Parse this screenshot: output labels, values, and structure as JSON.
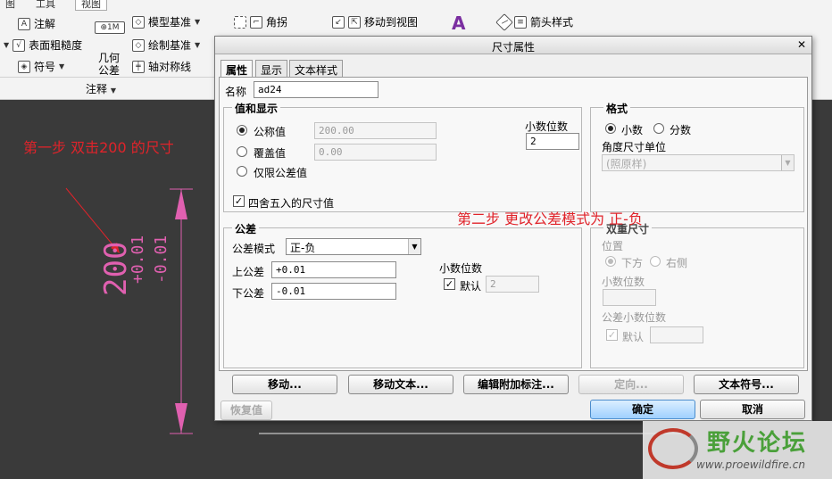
{
  "ribbon": {
    "tabs": [
      "图",
      "工具",
      "视图"
    ],
    "col1": [
      "注解",
      "表面粗糙度",
      "符号"
    ],
    "col2": [
      "1M",
      "几何",
      "公差"
    ],
    "col3": [
      "模型基准",
      "绘制基准",
      "轴对称线"
    ],
    "col4": [
      "角拐"
    ],
    "col5": [
      "移动到视图"
    ],
    "col6": [
      "箭头样式"
    ],
    "group_label": "注释"
  },
  "canvas": {
    "step1": "第一步  双击200 的尺寸",
    "step2": "第二步  更改公差模式为  正-负",
    "dim_value": "200",
    "tol_upper": "+0.01",
    "tol_lower": "-0.01"
  },
  "dialog": {
    "title": "尺寸属性",
    "tabs": [
      "属性",
      "显示",
      "文本样式"
    ],
    "name_label": "名称",
    "name_value": "ad24",
    "value_group": {
      "title": "值和显示",
      "nominal_label": "公称值",
      "nominal_value": "200.00",
      "override_label": "覆盖值",
      "override_value": "0.00",
      "tol_only_label": "仅限公差值",
      "decimals_label": "小数位数",
      "decimals_value": "2",
      "round_label": "四舍五入的尺寸值"
    },
    "format_group": {
      "title": "格式",
      "decimal_label": "小数",
      "fraction_label": "分数",
      "angle_unit_label": "角度尺寸单位",
      "angle_unit_value": "(照原样)"
    },
    "tolerance_group": {
      "title": "公差",
      "mode_label": "公差模式",
      "mode_value": "正-负",
      "upper_label": "上公差",
      "upper_value": "+0.01",
      "lower_label": "下公差",
      "lower_value": "-0.01",
      "decimals_label": "小数位数",
      "default_label": "默认",
      "decimals_value": "2"
    },
    "dual_group": {
      "title": "双重尺寸",
      "position_label": "位置",
      "below_label": "下方",
      "right_label": "右侧",
      "decimals_label": "小数位数",
      "tol_decimals_label": "公差小数位数",
      "default_label": "默认"
    },
    "buttons": {
      "move": "移动...",
      "move_text": "移动文本...",
      "edit_attach": "编辑附加标注...",
      "orient": "定向...",
      "text_symbol": "文本符号...",
      "restore": "恢复值",
      "ok": "确定",
      "cancel": "取消"
    }
  },
  "watermark": {
    "title": "野火论坛",
    "url": "www.proewildfire.cn"
  }
}
